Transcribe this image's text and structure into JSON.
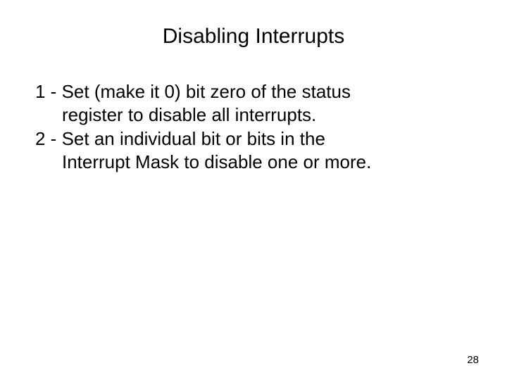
{
  "slide": {
    "title": "Disabling Interrupts",
    "items": [
      {
        "line1": "1 - Set (make it 0) bit zero of the status",
        "line2": "register to disable all interrupts."
      },
      {
        "line1": "2 - Set an individual bit or bits in the",
        "line2": "Interrupt Mask to disable one or more."
      }
    ],
    "page_number": "28"
  }
}
